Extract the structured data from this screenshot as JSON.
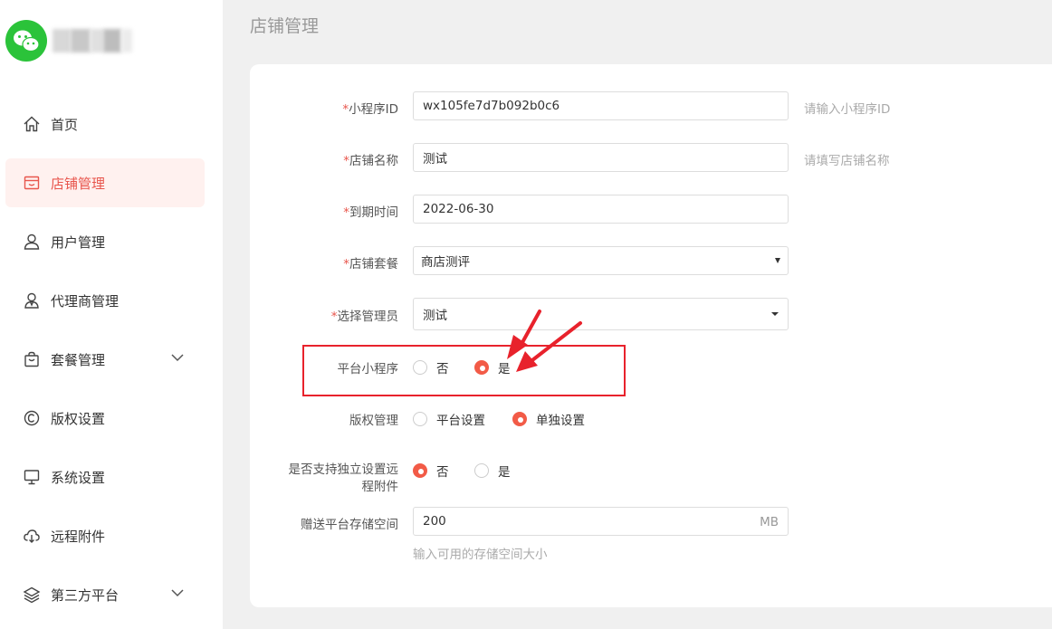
{
  "colors": {
    "accent": "#e8554c",
    "radio_on": "#f25b47",
    "highlight_box": "#e8222c",
    "logo": "#2bc33a"
  },
  "page_title": "店铺管理",
  "nav": [
    {
      "label": "首页",
      "icon": "home-icon"
    },
    {
      "label": "店铺管理",
      "icon": "store-icon",
      "active": true
    },
    {
      "label": "用户管理",
      "icon": "user-icon"
    },
    {
      "label": "代理商管理",
      "icon": "agent-icon"
    },
    {
      "label": "套餐管理",
      "icon": "bag-icon",
      "expandable": true
    },
    {
      "label": "版权设置",
      "icon": "copyright-icon"
    },
    {
      "label": "系统设置",
      "icon": "monitor-icon"
    },
    {
      "label": "远程附件",
      "icon": "cloud-download-icon"
    },
    {
      "label": "第三方平台",
      "icon": "layers-icon",
      "expandable": true
    }
  ],
  "form": {
    "appid": {
      "label": "小程序ID",
      "value": "wx105fe7d7b092b0c6",
      "hint": "请输入小程序ID"
    },
    "shop_name": {
      "label": "店铺名称",
      "value": "测试",
      "hint": "请填写店铺名称"
    },
    "expire": {
      "label": "到期时间",
      "value": "2022-06-30"
    },
    "package": {
      "label": "店铺套餐",
      "value": "商店测评"
    },
    "admin": {
      "label": "选择管理员",
      "value": "测试"
    },
    "platform_mini": {
      "label": "平台小程序",
      "opt_no": "否",
      "opt_yes": "是",
      "selected": "是"
    },
    "copyright": {
      "label": "版权管理",
      "opt_platform": "平台设置",
      "opt_separate": "单独设置",
      "selected": "单独设置"
    },
    "remote": {
      "label_line1": "是否支持独立设置远",
      "label_line2": "程附件",
      "opt_no": "否",
      "opt_yes": "是",
      "selected": "否"
    },
    "storage": {
      "label": "赠送平台存储空间",
      "value": "200",
      "unit": "MB",
      "hint": "输入可用的存储空间大小"
    }
  }
}
